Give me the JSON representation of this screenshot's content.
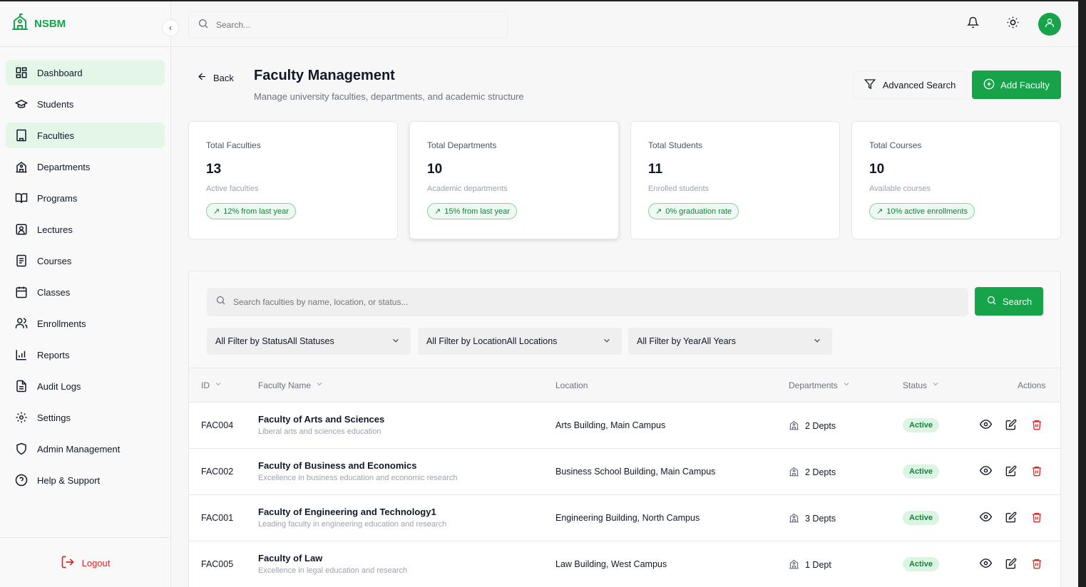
{
  "brand": {
    "name": "NSBM"
  },
  "sidebar": {
    "items": [
      {
        "label": "Dashboard",
        "icon": "dashboard-icon",
        "active": true
      },
      {
        "label": "Students",
        "icon": "graduation-cap-icon"
      },
      {
        "label": "Faculties",
        "icon": "building-icon",
        "active": true
      },
      {
        "label": "Departments",
        "icon": "school-icon"
      },
      {
        "label": "Programs",
        "icon": "book-open-icon"
      },
      {
        "label": "Lectures",
        "icon": "user-square-icon"
      },
      {
        "label": "Courses",
        "icon": "file-text-icon"
      },
      {
        "label": "Classes",
        "icon": "calendar-icon"
      },
      {
        "label": "Enrollments",
        "icon": "users-icon"
      },
      {
        "label": "Reports",
        "icon": "bar-chart-icon"
      },
      {
        "label": "Audit Logs",
        "icon": "document-icon"
      },
      {
        "label": "Settings",
        "icon": "gear-icon"
      },
      {
        "label": "Admin Management",
        "icon": "shield-icon"
      },
      {
        "label": "Help & Support",
        "icon": "help-circle-icon"
      }
    ],
    "logout_label": "Logout"
  },
  "topbar": {
    "search_placeholder": "Search..."
  },
  "header": {
    "back_label": "Back",
    "title": "Faculty Management",
    "subtitle": "Manage university faculties, departments, and academic structure",
    "advanced_search_label": "Advanced Search",
    "add_faculty_label": "Add Faculty"
  },
  "stats": [
    {
      "label": "Total Faculties",
      "value": "13",
      "desc": "Active faculties",
      "badge": "12% from last year"
    },
    {
      "label": "Total Departments",
      "value": "10",
      "desc": "Academic departments",
      "badge": "15% from last year"
    },
    {
      "label": "Total Students",
      "value": "11",
      "desc": "Enrolled students",
      "badge": "0% graduation rate"
    },
    {
      "label": "Total Courses",
      "value": "10",
      "desc": "Available courses",
      "badge": "10% active enrollments"
    }
  ],
  "filters": {
    "search_placeholder": "Search faculties by name, location, or status...",
    "search_button": "Search",
    "status_select": "All Filter by StatusAll Statuses",
    "location_select": "All Filter by LocationAll Locations",
    "year_select": "All Filter by YearAll Years"
  },
  "table": {
    "headers": {
      "id": "ID",
      "name": "Faculty Name",
      "location": "Location",
      "departments": "Departments",
      "status": "Status",
      "actions": "Actions"
    },
    "rows": [
      {
        "id": "FAC004",
        "name": "Faculty of Arts and Sciences",
        "desc": "Liberal arts and sciences education",
        "location": "Arts Building, Main Campus",
        "departments": "2 Depts",
        "status": "Active"
      },
      {
        "id": "FAC002",
        "name": "Faculty of Business and Economics",
        "desc": "Excellence in business education and economic research",
        "location": "Business School Building, Main Campus",
        "departments": "2 Depts",
        "status": "Active"
      },
      {
        "id": "FAC001",
        "name": "Faculty of Engineering and Technology1",
        "desc": "Leading faculty in engineering education and research",
        "location": "Engineering Building, North Campus",
        "departments": "3 Depts",
        "status": "Active"
      },
      {
        "id": "FAC005",
        "name": "Faculty of Law",
        "desc": "Excellence in legal education and research",
        "location": "Law Building, West Campus",
        "departments": "1 Dept",
        "status": "Active"
      }
    ]
  },
  "colors": {
    "primary": "#16a34a",
    "danger": "#dc2626",
    "active_nav": "#e3f6e8"
  }
}
